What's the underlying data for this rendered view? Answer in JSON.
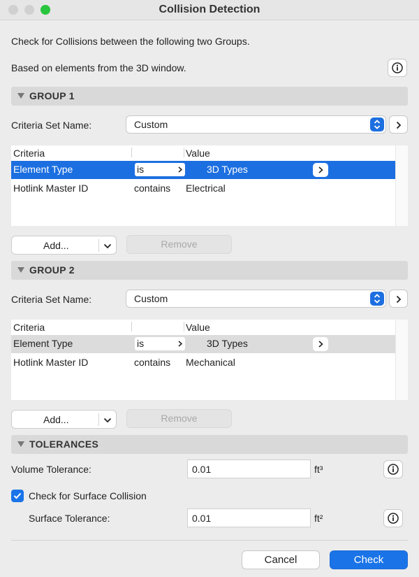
{
  "window": {
    "title": "Collision Detection"
  },
  "intro": {
    "line1": "Check for Collisions between the following two Groups.",
    "line2": "Based on elements from the 3D window."
  },
  "group1": {
    "header": "GROUP 1",
    "criteria_set_label": "Criteria Set Name:",
    "criteria_set_value": "Custom",
    "columns": [
      "Criteria",
      "Value"
    ],
    "rows": [
      {
        "criteria": "Element Type",
        "operator": "is",
        "value": "3D Types",
        "selected": true
      },
      {
        "criteria": "Hotlink Master ID",
        "operator": "contains",
        "value": "Electrical"
      }
    ],
    "add_label": "Add...",
    "remove_label": "Remove"
  },
  "group2": {
    "header": "GROUP 2",
    "criteria_set_label": "Criteria Set Name:",
    "criteria_set_value": "Custom",
    "columns": [
      "Criteria",
      "Value"
    ],
    "rows": [
      {
        "criteria": "Element Type",
        "operator": "is",
        "value": "3D Types",
        "selected": false
      },
      {
        "criteria": "Hotlink Master ID",
        "operator": "contains",
        "value": "Mechanical"
      }
    ],
    "add_label": "Add...",
    "remove_label": "Remove"
  },
  "tolerances": {
    "header": "TOLERANCES",
    "volume_label": "Volume Tolerance:",
    "volume_value": "0.01",
    "volume_unit": "ft³",
    "surface_check_label": "Check for Surface Collision",
    "surface_check_checked": true,
    "surface_label": "Surface Tolerance:",
    "surface_value": "0.01",
    "surface_unit": "ft²"
  },
  "footer": {
    "cancel_label": "Cancel",
    "check_label": "Check"
  },
  "colors": {
    "accent": "#1a74e8",
    "selection": "#1c6fe0"
  }
}
